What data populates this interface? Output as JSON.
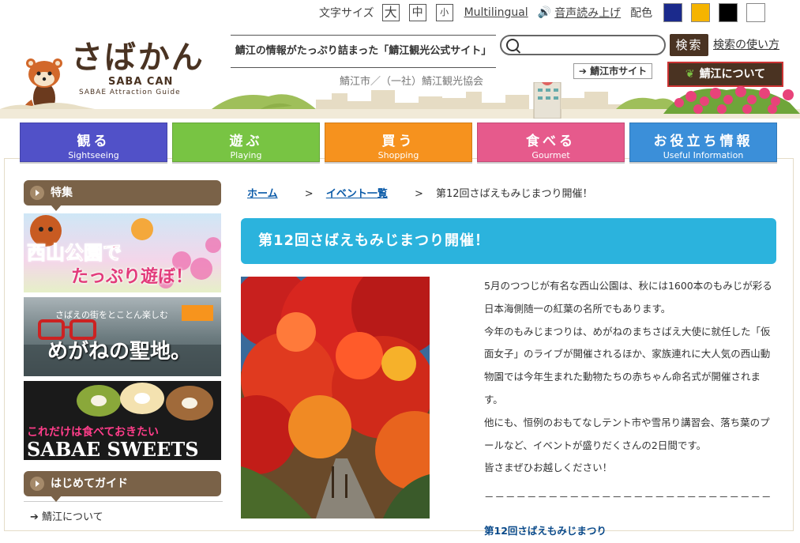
{
  "toolbar": {
    "font_size_label": "文字サイズ",
    "size_large": "大",
    "size_medium": "中",
    "size_small": "小",
    "multilingual": "Multilingual",
    "read_aloud": "音声読み上げ",
    "color_label": "配色",
    "color_options": [
      "#1b2a8c",
      "#f5b400",
      "#000000",
      "#ffffff"
    ]
  },
  "logo": {
    "title": "さばかん",
    "subtitle": "SABA CAN",
    "tagline": "SABAE Attraction Guide"
  },
  "header": {
    "site_tagline": "鯖江の情報がたっぷり詰まった「鯖江観光公式サイト」",
    "organization": "鯖江市／（一社）鯖江観光協会",
    "search_placeholder": "",
    "search_button": "検索",
    "search_help": "検索の使い方",
    "city_site_link": "鯖江市サイト",
    "about_button": "鯖江について"
  },
  "nav": [
    {
      "jp": "観る",
      "en": "Sightseeing",
      "color": "#4f4fc9"
    },
    {
      "jp": "遊ぶ",
      "en": "Playing",
      "color": "#76c442"
    },
    {
      "jp": "買う",
      "en": "Shopping",
      "color": "#f5921e"
    },
    {
      "jp": "食べる",
      "en": "Gourmet",
      "color": "#e85a8a"
    },
    {
      "jp": "お役立ち情報",
      "en": "Useful Information",
      "color": "#3a8ed8"
    }
  ],
  "sidebar": {
    "feature_heading": "特集",
    "banners": [
      {
        "line1": "西山公園で",
        "line2": "たっぷり遊ぼ！"
      },
      {
        "line1": "さばえの街をとことん楽しむ",
        "line2": "めがねの聖地。"
      },
      {
        "line1": "これだけは食べておきたい",
        "line2": "SABAE SWEETS"
      }
    ],
    "guide_heading": "はじめてガイド",
    "guide_link": "鯖江について"
  },
  "breadcrumb": {
    "home": "ホーム",
    "events": "イベント一覧",
    "current": "第12回さばえもみじまつり開催！"
  },
  "article": {
    "title": "第12回さばえもみじまつり開催！",
    "paragraphs": [
      "5月のつつじが有名な西山公園は、秋には1600本のもみじが彩る日本海側随一の紅葉の名所でもあります。",
      "今年のもみじまつりは、めがねのまちさばえ大使に就任した「仮面女子」のライブが開催されるほか、家族連れに大人気の西山動物園では今年生まれた動物たちの赤ちゃん命名式が開催されます。",
      "他にも、恒例のおもてなしテント市や雪吊り講習会、落ち葉のプールなど、イベントが盛りだくさんの2日間です。",
      "皆さまぜひお越しください！"
    ],
    "divider": "－－－－－－－－－－－－－－－－－－－－－－－－－－－",
    "subheading": "第12回さばえもみじまつり"
  }
}
